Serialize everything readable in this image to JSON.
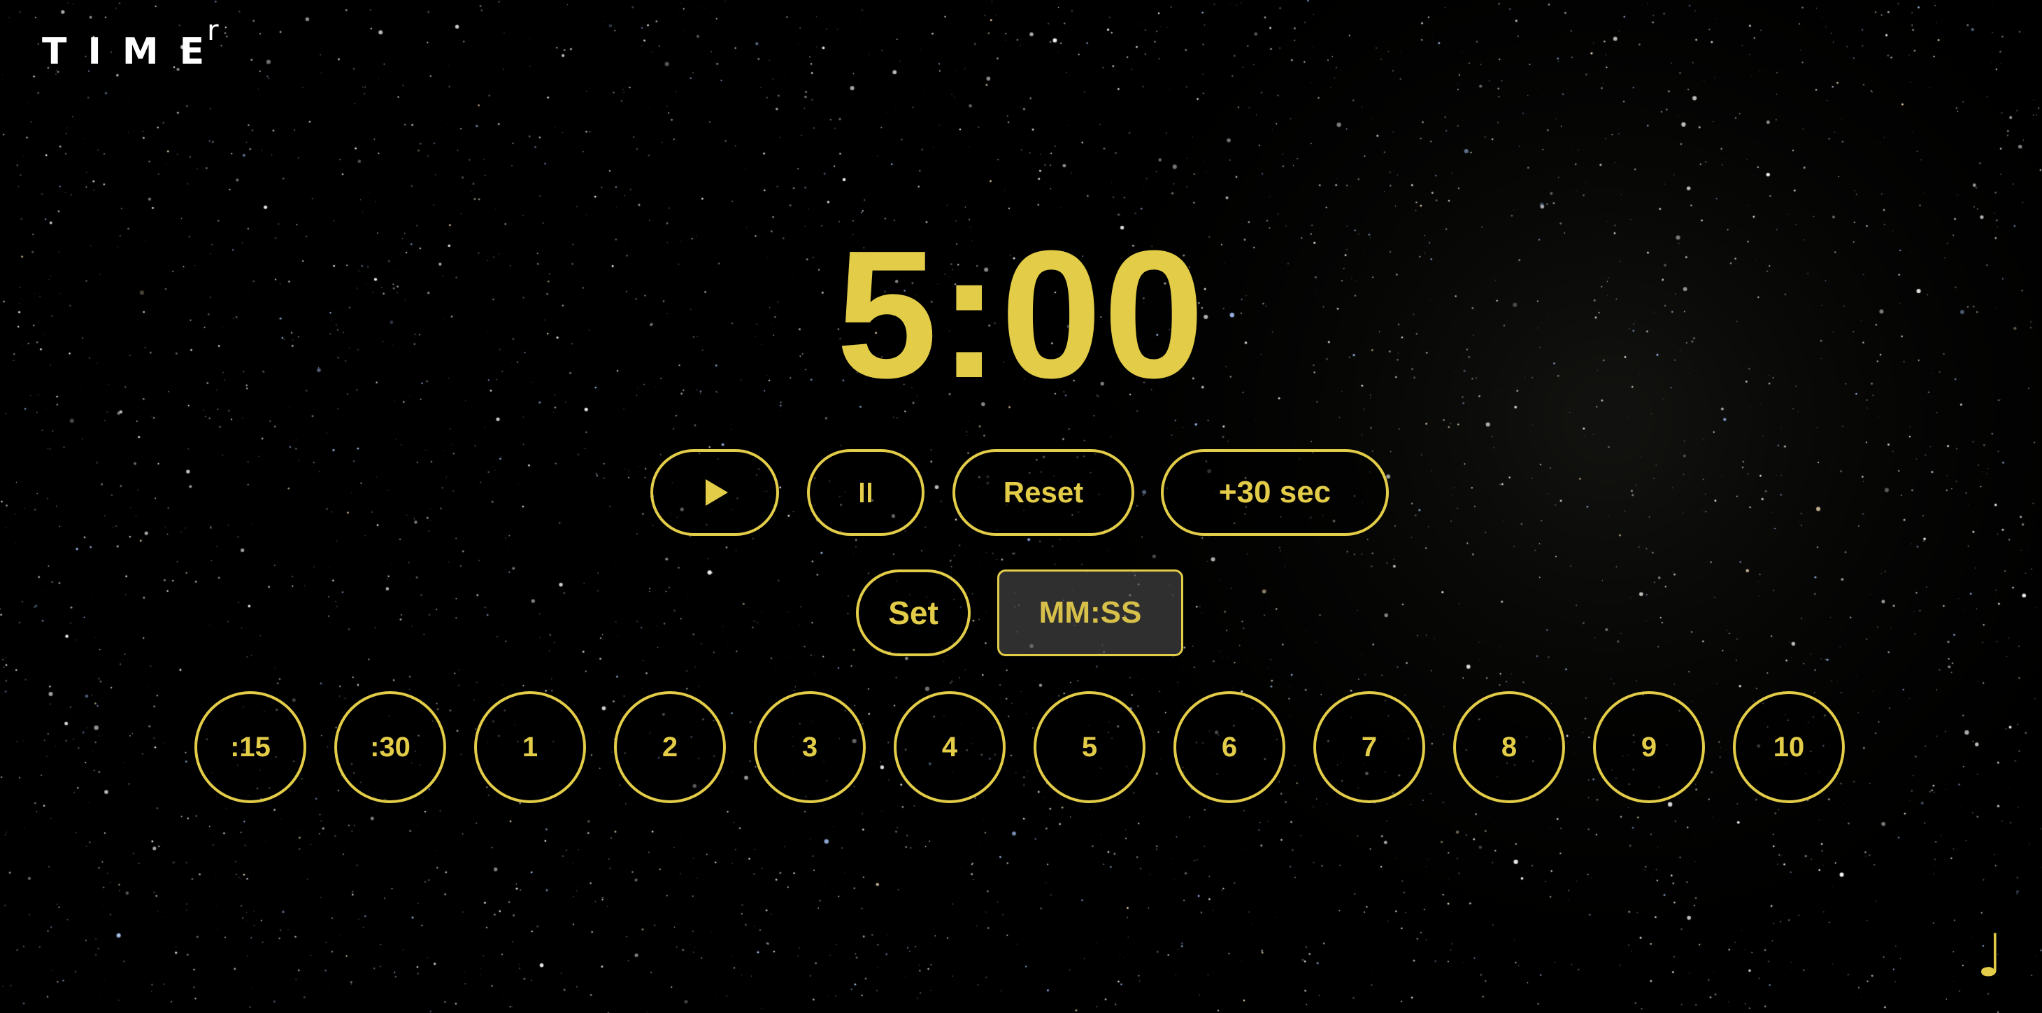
{
  "app": {
    "logo_text": "TIME",
    "logo_superscript": "r"
  },
  "clock": {
    "display": "5:00"
  },
  "controls": {
    "play_icon": "play-icon",
    "pause_icon": "pause-icon",
    "reset_label": "Reset",
    "add_label": "+30 sec"
  },
  "set_row": {
    "set_label": "Set",
    "input_placeholder": "MM:SS",
    "input_value": ""
  },
  "presets": [
    ":15",
    ":30",
    "1",
    "2",
    "3",
    "4",
    "5",
    "6",
    "7",
    "8",
    "9",
    "10"
  ],
  "sound": {
    "icon": "music-note-icon",
    "glyph": "♩"
  },
  "colors": {
    "accent": "#e2cc48",
    "logo": "#ffffff",
    "background": "#000000"
  }
}
